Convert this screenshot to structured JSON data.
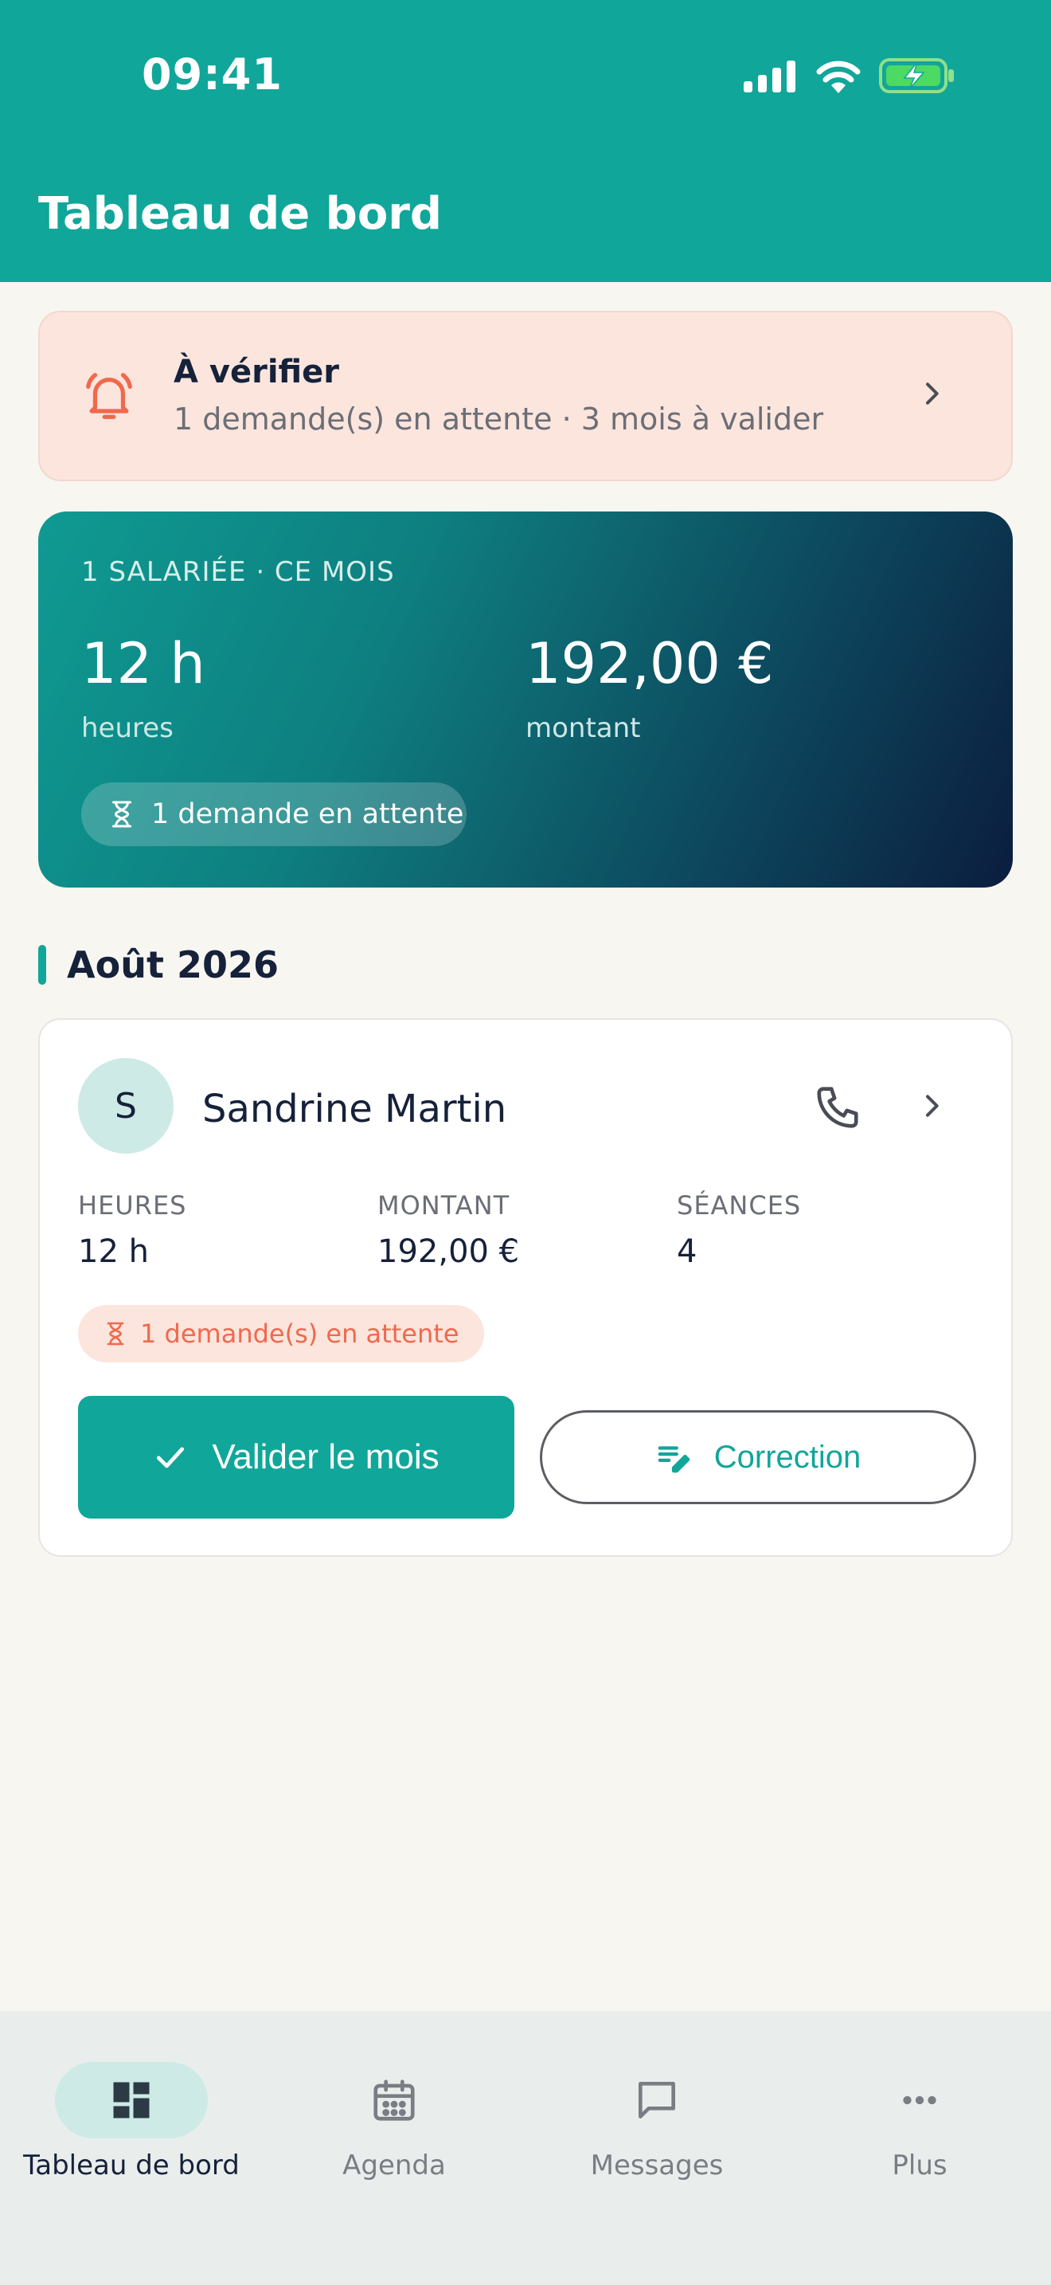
{
  "status_bar": {
    "time": "09:41"
  },
  "header": {
    "title": "Tableau de bord"
  },
  "alert": {
    "title": "À vérifier",
    "subtitle": "1 demande(s) en attente · 3 mois à valider"
  },
  "summary": {
    "kicker": "1 SALARIÉE · CE MOIS",
    "hours_value": "12 h",
    "hours_label": "heures",
    "amount_value": "192,00 €",
    "amount_label": "montant",
    "pending": "1 demande en attente"
  },
  "section": {
    "title": "Août 2026"
  },
  "employee": {
    "initial": "S",
    "name": "Sandrine Martin",
    "stats": [
      {
        "label": "HEURES",
        "value": "12 h"
      },
      {
        "label": "MONTANT",
        "value": "192,00 €"
      },
      {
        "label": "SÉANCES",
        "value": "4"
      }
    ],
    "pending": "1 demande(s) en attente",
    "validate_label": "Valider le mois",
    "correction_label": "Correction"
  },
  "nav": {
    "items": [
      {
        "label": "Tableau de bord",
        "icon": "dashboard-icon",
        "active": true
      },
      {
        "label": "Agenda",
        "icon": "calendar-icon",
        "active": false
      },
      {
        "label": "Messages",
        "icon": "chat-icon",
        "active": false
      },
      {
        "label": "Plus",
        "icon": "more-icon",
        "active": false
      }
    ]
  },
  "colors": {
    "primary": "#11a69a",
    "alert_bg": "#fbe5dd",
    "alert_accent": "#f0694d",
    "dark": "#16213a",
    "background": "#f8f6f1"
  }
}
